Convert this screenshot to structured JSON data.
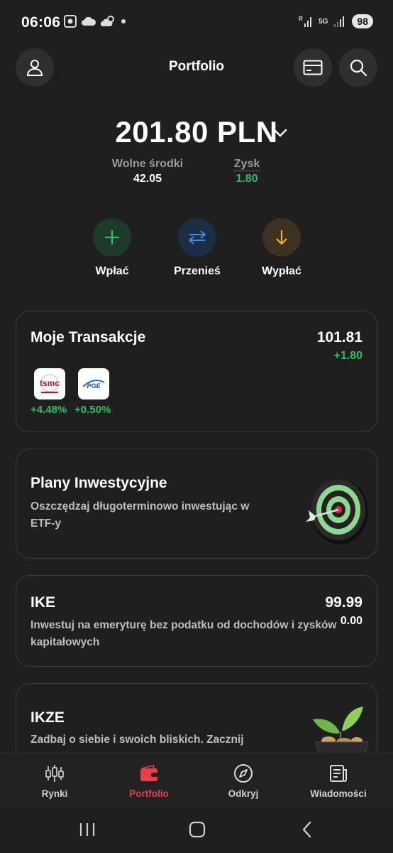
{
  "status_bar": {
    "time": "06:06",
    "battery": "98",
    "network": "5G"
  },
  "header": {
    "title": "Portfolio"
  },
  "balance": {
    "amount": "201.80 PLN",
    "free_funds_label": "Wolne środki",
    "free_funds_value": "42.05",
    "profit_label": "Zysk",
    "profit_value": "1.80"
  },
  "actions": [
    {
      "label": "Wpłać",
      "icon": "plus-icon",
      "color": "#2fbf5f"
    },
    {
      "label": "Przenieś",
      "icon": "transfer-arrows-icon",
      "color": "#3a8ee6"
    },
    {
      "label": "Wypłać",
      "icon": "arrow-down-icon",
      "color": "#f2b531"
    }
  ],
  "transactions_card": {
    "title": "Moje Transakcje",
    "value": "101.81",
    "change": "+1.80",
    "holdings": [
      {
        "logo_text": "tsmc",
        "change": "+4.48%"
      },
      {
        "logo_text": "PGE",
        "change": "+0.50%"
      }
    ]
  },
  "plans_card": {
    "title": "Plany Inwestycyjne",
    "description_line1": "Oszczędzaj długoterminowo inwestując w",
    "description_line2": "ETF-y",
    "icon": "target-dart-icon"
  },
  "ike_card": {
    "title": "IKE",
    "value": "99.99",
    "change": "0.00",
    "description_line1": "Inwestuj na emeryturę bez podatku od dochodów i zysków",
    "description_line2": "kapitałowych"
  },
  "ikze_card": {
    "title": "IKZE",
    "description_line1": "Zadbaj o siebie i swoich bliskich. Zacznij",
    "icon": "plant-pot-icon"
  },
  "bottom_nav": [
    {
      "label": "Rynki",
      "icon": "candlestick-icon",
      "active": false
    },
    {
      "label": "Portfolio",
      "icon": "wallet-icon",
      "active": true
    },
    {
      "label": "Odkryj",
      "icon": "compass-icon",
      "active": false
    },
    {
      "label": "Wiadomości",
      "icon": "news-icon",
      "active": false
    }
  ],
  "colors": {
    "background": "#1f1f1f",
    "positive": "#2fbf5f",
    "accent_red": "#e8404a",
    "card_border": "#3a3a3a"
  }
}
